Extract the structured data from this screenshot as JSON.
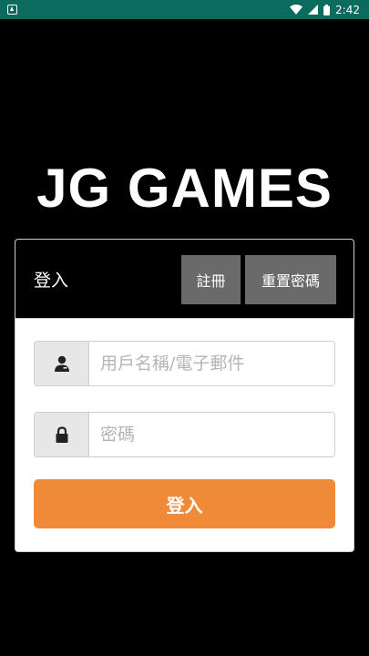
{
  "status_bar": {
    "time": "2:42",
    "icons": [
      "app-notification-icon",
      "wifi-icon",
      "signal-icon",
      "battery-icon"
    ]
  },
  "brand": {
    "title": "JG GAMES"
  },
  "login_card": {
    "title": "登入",
    "register_label": "註冊",
    "reset_password_label": "重置密碼",
    "username": {
      "placeholder": "用戶名稱/電子郵件",
      "value": "",
      "icon": "user-icon"
    },
    "password": {
      "placeholder": "密碼",
      "value": "",
      "icon": "lock-icon"
    },
    "submit_label": "登入"
  },
  "colors": {
    "status_bar": "#0b6b5e",
    "background": "#000000",
    "header_button": "#6a6a6a",
    "primary_button": "#ef8a38",
    "addon": "#e7e7e7"
  }
}
